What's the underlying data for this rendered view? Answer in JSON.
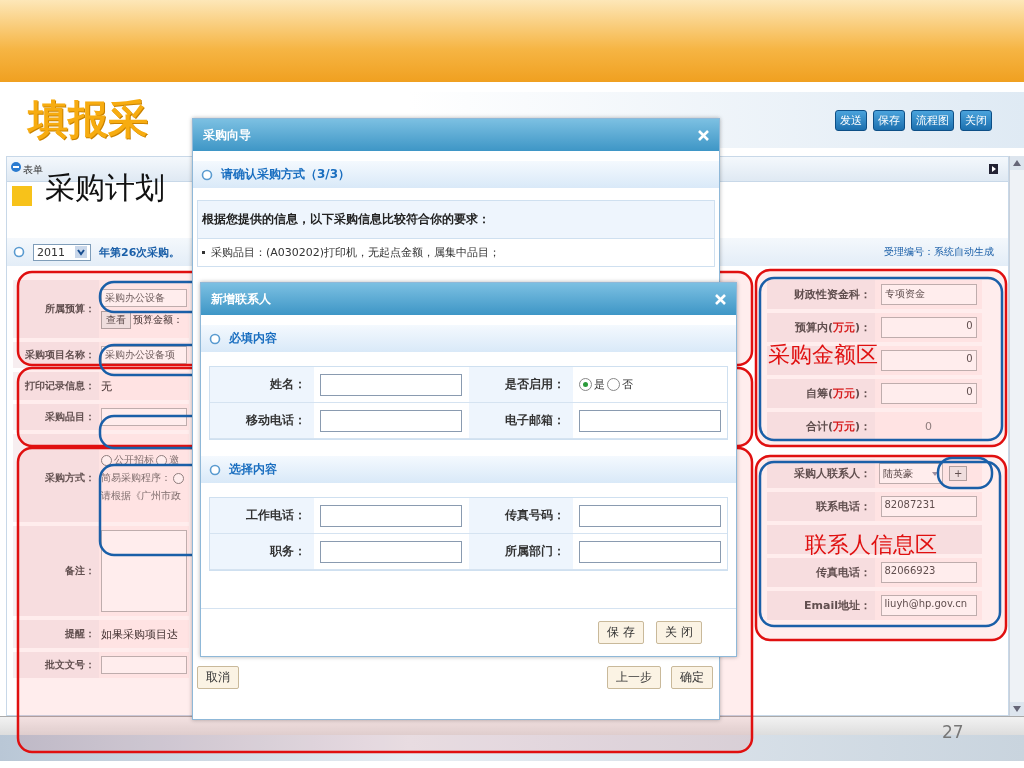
{
  "slide": {
    "title": "填报采",
    "bullet": "采购计划",
    "page_number": "27"
  },
  "app": {
    "toolbar_buttons": [
      "发送",
      "保存",
      "流程图",
      "关闭"
    ],
    "panel_title": "表单",
    "year": "2011",
    "round_text": "年第26次采购。",
    "acceptance_no": "受理编号：系统自动生成",
    "left_form": [
      {
        "kind": "budget",
        "label": "所属预算：",
        "value": "采购办公设备",
        "button": "查看",
        "sub_label": "预算金额："
      },
      {
        "kind": "input",
        "label": "采购项目名称：",
        "value": "采购办公设备项"
      },
      {
        "kind": "text",
        "label": "打印记录信息：",
        "value": "无"
      },
      {
        "kind": "input",
        "label": "采购品目："
      },
      {
        "kind": "method",
        "label": "采购方式：",
        "options": [
          {
            "label": "公开招标",
            "selected": false
          },
          {
            "label": "邀",
            "selected": false
          }
        ],
        "simple": {
          "label": "简易采购程序：",
          "selected": false
        },
        "hint": "请根据《广州市政"
      },
      {
        "kind": "textarea",
        "label": "备注："
      },
      {
        "kind": "text",
        "label": "提醒：",
        "value": "如果采购项目达"
      },
      {
        "kind": "input",
        "label": "批文文号："
      }
    ],
    "right_form": [
      {
        "kind": "input",
        "label": "财政性资金科：",
        "value": "专项资金"
      },
      {
        "kind": "amount",
        "label": "预算内(",
        "unit": "万元",
        "label_end": ")：",
        "value": "0"
      },
      {
        "kind": "amount",
        "value": "0"
      },
      {
        "kind": "amount",
        "label": "自筹(",
        "unit": "万元",
        "label_end": ")：",
        "value": "0"
      },
      {
        "kind": "total",
        "label": "合计(",
        "unit": "万元",
        "label_end": ")：",
        "value": "0"
      },
      {
        "kind": "select",
        "label": "采购人联系人：",
        "value": "陆英豪",
        "button": "+"
      },
      {
        "kind": "input",
        "label": "联系电话：",
        "value": "82087231"
      },
      {
        "kind": "covered"
      },
      {
        "kind": "input",
        "label": "传真电话：",
        "value": "82066923"
      },
      {
        "kind": "input",
        "label": "Email地址：",
        "value": "liuyh@hp.gov.cn"
      }
    ]
  },
  "annotations": [
    {
      "label": "采购金额区"
    },
    {
      "label": "联系人信息区"
    }
  ],
  "wizard": {
    "title": "采购向导",
    "section": "请确认采购方式（3/3）",
    "intro": "根据您提供的信息，以下采购信息比较符合你的要求：",
    "items": [
      "采购品目：(A030202)打印机，无起点金额，属集中品目；"
    ],
    "left_button": "取消",
    "right_buttons": [
      "上一步",
      "确定"
    ]
  },
  "contact_dialog": {
    "title": "新增联系人",
    "sections": [
      {
        "title": "必填内容",
        "fields": [
          {
            "kind": "input",
            "label": "姓名："
          },
          {
            "kind": "radio",
            "label": "是否启用：",
            "options": [
              {
                "label": "是",
                "selected": true
              },
              {
                "label": "否",
                "selected": false
              }
            ]
          },
          {
            "kind": "input",
            "label": "移动电话："
          },
          {
            "kind": "input",
            "label": "电子邮箱："
          }
        ]
      },
      {
        "title": "选择内容",
        "fields": [
          {
            "kind": "input",
            "label": "工作电话："
          },
          {
            "kind": "input",
            "label": "传真号码："
          },
          {
            "kind": "input",
            "label": "职务："
          },
          {
            "kind": "input",
            "label": "所属部门："
          }
        ]
      }
    ],
    "buttons": [
      "保 存",
      "关 闭"
    ]
  }
}
